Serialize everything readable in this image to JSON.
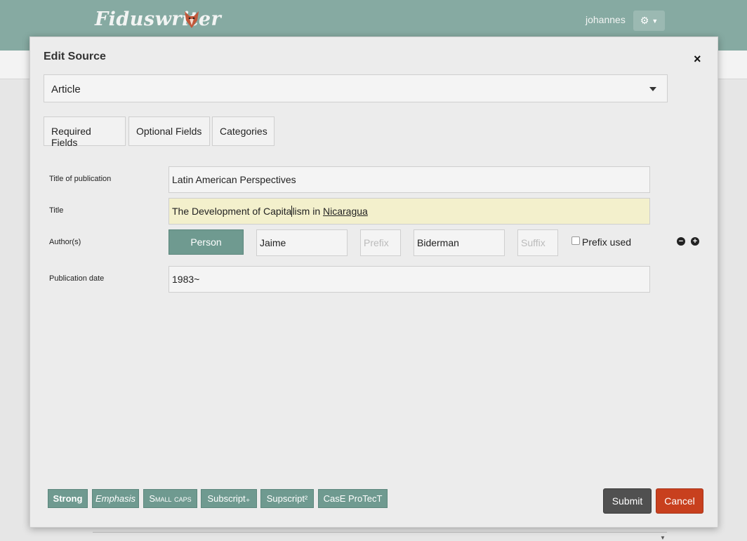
{
  "app": {
    "logo": "Fiduswriter",
    "user": "johannes"
  },
  "dialog": {
    "title": "Edit Source",
    "close": "×",
    "source_type": "Article",
    "tabs": [
      "Required Fields",
      "Optional Fields",
      "Categories"
    ]
  },
  "fields": {
    "journal_label": "Title of publication",
    "journal_value": "Latin American Perspectives",
    "title_label": "Title",
    "title_part1": "The Development of Capita",
    "title_part2": "lism in ",
    "title_link": "Nicaragua",
    "authors_label": "Author(s)",
    "author_type": "Person",
    "given": "Jaime",
    "prefix_placeholder": "Prefix",
    "family": "Biderman",
    "suffix_placeholder": "Suffix",
    "prefix_used": "Prefix used",
    "date_label": "Publication date",
    "date_value": "1983~"
  },
  "formatting": {
    "strong": "Strong",
    "emphasis": "Emphasis",
    "smallcaps": "Small caps",
    "subscript": "Subscript₊",
    "supscript": "Supscript²",
    "case_protect": "CasE ProTecT"
  },
  "actions": {
    "submit": "Submit",
    "cancel": "Cancel"
  },
  "colors": {
    "header": "#86aaa2",
    "accent": "#6f9a90",
    "submit": "#505050",
    "cancel": "#c8401e",
    "highlight": "#f3f0cc"
  },
  "icons": [
    "fox-logo-icon",
    "gear-icon",
    "chevron-down-icon",
    "close-icon",
    "remove-circle-icon",
    "add-circle-icon"
  ]
}
